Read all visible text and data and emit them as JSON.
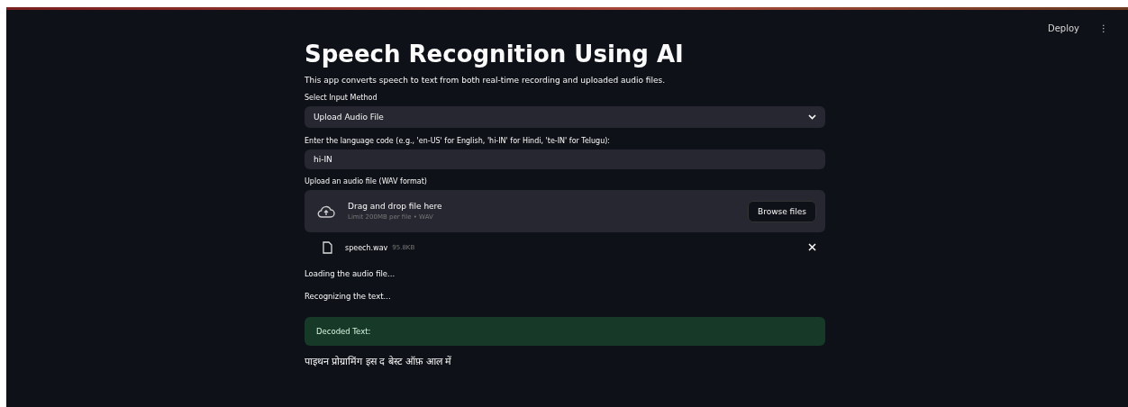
{
  "header": {
    "deploy": "Deploy",
    "menu": "⋮"
  },
  "title": "Speech Recognition Using AI",
  "description": "This app converts speech to text from both real-time recording and uploaded audio files.",
  "input_method": {
    "label": "Select Input Method",
    "value": "Upload Audio File"
  },
  "language": {
    "label": "Enter the language code (e.g., 'en-US' for English, 'hi-IN' for Hindi, 'te-IN' for Telugu):",
    "value": "hi-IN"
  },
  "uploader": {
    "label": "Upload an audio file (WAV format)",
    "title": "Drag and drop file here",
    "hint": "Limit 200MB per file • WAV",
    "button": "Browse files"
  },
  "file": {
    "name": "speech.wav",
    "size": "95.8KB"
  },
  "messages": [
    "Loading the audio file...",
    "Recognizing the text..."
  ],
  "result": {
    "label": "Decoded Text:",
    "text": "पाइथन प्रोग्रामिंग इस द बेस्ट ऑफ़ आल में"
  }
}
